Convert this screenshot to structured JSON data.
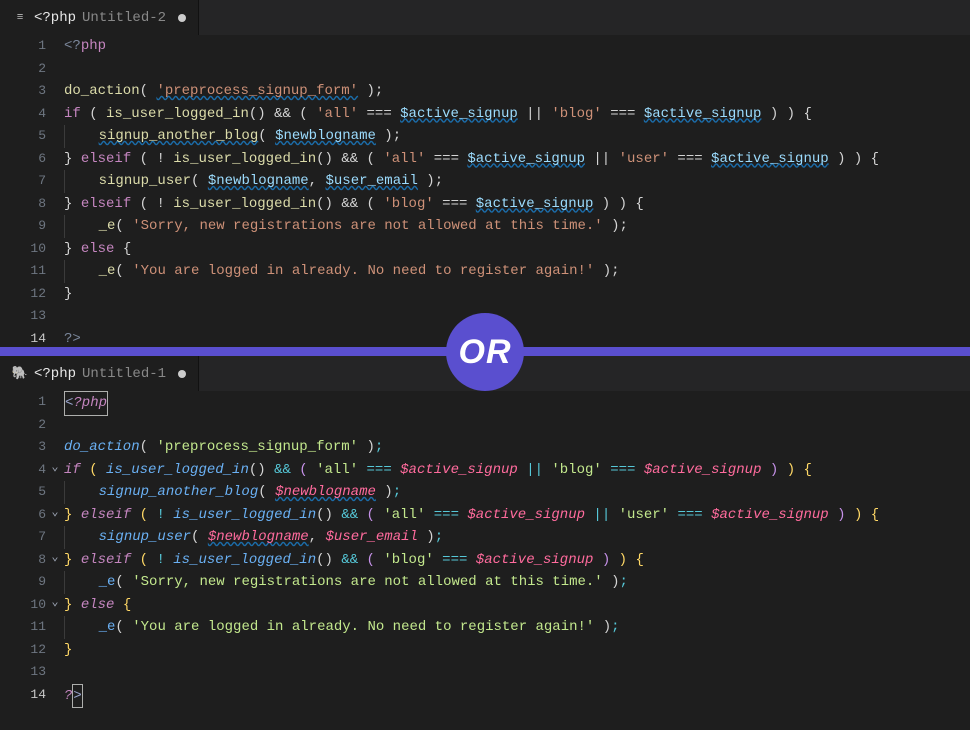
{
  "divider_label": "OR",
  "top": {
    "tab": {
      "lang": "<?php",
      "name": "Untitled-2"
    },
    "lines": [
      {
        "n": 1,
        "tokens": [
          [
            "<?",
            "t-tag"
          ],
          [
            "php",
            "t-kw"
          ]
        ]
      },
      {
        "n": 2,
        "tokens": []
      },
      {
        "n": 3,
        "tokens": [
          [
            "do_action",
            "t-fn"
          ],
          [
            "( ",
            "t-pun"
          ],
          [
            "'preprocess_signup_form'",
            "t-str wav"
          ],
          [
            " );",
            "t-pun"
          ]
        ]
      },
      {
        "n": 4,
        "tokens": [
          [
            "if",
            "t-kw"
          ],
          [
            " ( ",
            "t-pun"
          ],
          [
            "is_user_logged_in",
            "t-fn"
          ],
          [
            "() ",
            "t-pun"
          ],
          [
            "&& ",
            "t-op"
          ],
          [
            "( ",
            "t-pun"
          ],
          [
            "'all'",
            "t-str"
          ],
          [
            " === ",
            "t-op"
          ],
          [
            "$active_signup",
            "t-var wav"
          ],
          [
            " || ",
            "t-op"
          ],
          [
            "'blog'",
            "t-str"
          ],
          [
            " === ",
            "t-op"
          ],
          [
            "$active_signup",
            "t-var wav"
          ],
          [
            " ) ) {",
            "t-pun"
          ]
        ]
      },
      {
        "n": 5,
        "indent": 1,
        "tokens": [
          [
            "signup_another_blog",
            "t-fn wav"
          ],
          [
            "( ",
            "t-pun"
          ],
          [
            "$newblogname",
            "t-var wav"
          ],
          [
            " );",
            "t-pun"
          ]
        ]
      },
      {
        "n": 6,
        "tokens": [
          [
            "} ",
            "t-pun"
          ],
          [
            "elseif",
            "t-kw"
          ],
          [
            " ( ",
            "t-pun"
          ],
          [
            "! ",
            "t-op"
          ],
          [
            "is_user_logged_in",
            "t-fn"
          ],
          [
            "() ",
            "t-pun"
          ],
          [
            "&& ",
            "t-op"
          ],
          [
            "( ",
            "t-pun"
          ],
          [
            "'all'",
            "t-str"
          ],
          [
            " === ",
            "t-op"
          ],
          [
            "$active_signup",
            "t-var wav"
          ],
          [
            " || ",
            "t-op"
          ],
          [
            "'user'",
            "t-str"
          ],
          [
            " === ",
            "t-op"
          ],
          [
            "$active_signup",
            "t-var wav"
          ],
          [
            " ) ) {",
            "t-pun"
          ]
        ]
      },
      {
        "n": 7,
        "indent": 1,
        "tokens": [
          [
            "signup_user",
            "t-fn"
          ],
          [
            "( ",
            "t-pun"
          ],
          [
            "$newblogname",
            "t-var wav"
          ],
          [
            ", ",
            "t-pun"
          ],
          [
            "$user_email",
            "t-var wav"
          ],
          [
            " );",
            "t-pun"
          ]
        ]
      },
      {
        "n": 8,
        "tokens": [
          [
            "} ",
            "t-pun"
          ],
          [
            "elseif",
            "t-kw"
          ],
          [
            " ( ",
            "t-pun"
          ],
          [
            "! ",
            "t-op"
          ],
          [
            "is_user_logged_in",
            "t-fn"
          ],
          [
            "() ",
            "t-pun"
          ],
          [
            "&& ",
            "t-op"
          ],
          [
            "( ",
            "t-pun"
          ],
          [
            "'blog'",
            "t-str"
          ],
          [
            " === ",
            "t-op"
          ],
          [
            "$active_signup",
            "t-var wav"
          ],
          [
            " ) ) {",
            "t-pun"
          ]
        ]
      },
      {
        "n": 9,
        "indent": 1,
        "tokens": [
          [
            "_e",
            "t-fn"
          ],
          [
            "( ",
            "t-pun"
          ],
          [
            "'Sorry, new registrations are not allowed at this time.'",
            "t-str"
          ],
          [
            " );",
            "t-pun"
          ]
        ]
      },
      {
        "n": 10,
        "tokens": [
          [
            "} ",
            "t-pun"
          ],
          [
            "else",
            "t-kw"
          ],
          [
            " {",
            "t-pun"
          ]
        ]
      },
      {
        "n": 11,
        "indent": 1,
        "tokens": [
          [
            "_e",
            "t-fn"
          ],
          [
            "( ",
            "t-pun"
          ],
          [
            "'You are logged in already. No need to register again!'",
            "t-str"
          ],
          [
            " );",
            "t-pun"
          ]
        ]
      },
      {
        "n": 12,
        "tokens": [
          [
            "}",
            "t-pun"
          ]
        ]
      },
      {
        "n": 13,
        "tokens": []
      },
      {
        "n": 14,
        "cur": true,
        "tokens": [
          [
            "?>",
            "t-tag"
          ]
        ]
      }
    ]
  },
  "bottom": {
    "tab": {
      "lang": "<?php",
      "name": "Untitled-1"
    },
    "lines": [
      {
        "n": 1,
        "tokens": [
          [
            "<",
            "b-tag"
          ],
          [
            "?php",
            "b-kw"
          ]
        ],
        "boxstart": true
      },
      {
        "n": 2,
        "tokens": []
      },
      {
        "n": 3,
        "tokens": [
          [
            "do_action",
            "b-fn"
          ],
          [
            "( ",
            "t-pun"
          ],
          [
            "'preprocess_signup_form'",
            "b-str"
          ],
          [
            " )",
            "t-pun"
          ],
          [
            ";",
            "b-op"
          ]
        ]
      },
      {
        "n": 4,
        "fold": true,
        "tokens": [
          [
            "if",
            "b-kw"
          ],
          [
            " ",
            "t-pun"
          ],
          [
            "(",
            "b-brace"
          ],
          [
            " ",
            "t-pun"
          ],
          [
            "is_user_logged_in",
            "b-fn"
          ],
          [
            "()",
            " "
          ],
          [
            " ",
            "t-pun"
          ],
          [
            "&&",
            "b-op"
          ],
          [
            " ",
            "t-pun"
          ],
          [
            "(",
            "b-brace2"
          ],
          [
            " ",
            "t-pun"
          ],
          [
            "'all'",
            "b-str"
          ],
          [
            " ",
            "t-pun"
          ],
          [
            "===",
            "b-op"
          ],
          [
            " ",
            "t-pun"
          ],
          [
            "$active_signup",
            "b-var"
          ],
          [
            " ",
            "t-pun"
          ],
          [
            "||",
            "b-op"
          ],
          [
            " ",
            "t-pun"
          ],
          [
            "'blog'",
            "b-str"
          ],
          [
            " ",
            "t-pun"
          ],
          [
            "===",
            "b-op"
          ],
          [
            " ",
            "t-pun"
          ],
          [
            "$active_signup",
            "b-var"
          ],
          [
            " ",
            "t-pun"
          ],
          [
            ")",
            "b-brace2"
          ],
          [
            " ",
            "t-pun"
          ],
          [
            ")",
            "b-brace"
          ],
          [
            " ",
            "t-pun"
          ],
          [
            "{",
            "b-brace"
          ]
        ]
      },
      {
        "n": 5,
        "indent": 1,
        "tokens": [
          [
            "signup_another_blog",
            "b-fn"
          ],
          [
            "( ",
            "t-pun"
          ],
          [
            "$newblogname",
            "b-var wav"
          ],
          [
            " )",
            "t-pun"
          ],
          [
            ";",
            "b-op"
          ]
        ]
      },
      {
        "n": 6,
        "fold": true,
        "tokens": [
          [
            "}",
            "b-brace"
          ],
          [
            " ",
            "t-pun"
          ],
          [
            "elseif",
            "b-kw"
          ],
          [
            " ",
            "t-pun"
          ],
          [
            "(",
            "b-brace"
          ],
          [
            " ",
            "t-pun"
          ],
          [
            "!",
            "b-op"
          ],
          [
            " ",
            "t-pun"
          ],
          [
            "is_user_logged_in",
            "b-fn"
          ],
          [
            "()",
            " "
          ],
          [
            " ",
            "t-pun"
          ],
          [
            "&&",
            "b-op"
          ],
          [
            " ",
            "t-pun"
          ],
          [
            "(",
            "b-brace2"
          ],
          [
            " ",
            "t-pun"
          ],
          [
            "'all'",
            "b-str"
          ],
          [
            " ",
            "t-pun"
          ],
          [
            "===",
            "b-op"
          ],
          [
            " ",
            "t-pun"
          ],
          [
            "$active_signup",
            "b-var"
          ],
          [
            " ",
            "t-pun"
          ],
          [
            "||",
            "b-op"
          ],
          [
            " ",
            "t-pun"
          ],
          [
            "'user'",
            "b-str"
          ],
          [
            " ",
            "t-pun"
          ],
          [
            "===",
            "b-op"
          ],
          [
            " ",
            "t-pun"
          ],
          [
            "$active_signup",
            "b-var"
          ],
          [
            " ",
            "t-pun"
          ],
          [
            ")",
            "b-brace2"
          ],
          [
            " ",
            "t-pun"
          ],
          [
            ")",
            "b-brace"
          ],
          [
            " ",
            "t-pun"
          ],
          [
            "{",
            "b-brace"
          ]
        ]
      },
      {
        "n": 7,
        "indent": 1,
        "tokens": [
          [
            "signup_user",
            "b-fn"
          ],
          [
            "( ",
            "t-pun"
          ],
          [
            "$newblogname",
            "b-var wav"
          ],
          [
            ", ",
            "t-pun"
          ],
          [
            "$user_email",
            "b-var"
          ],
          [
            " )",
            "t-pun"
          ],
          [
            ";",
            "b-op"
          ]
        ]
      },
      {
        "n": 8,
        "fold": true,
        "tokens": [
          [
            "}",
            "b-brace"
          ],
          [
            " ",
            "t-pun"
          ],
          [
            "elseif",
            "b-kw"
          ],
          [
            " ",
            "t-pun"
          ],
          [
            "(",
            "b-brace"
          ],
          [
            " ",
            "t-pun"
          ],
          [
            "!",
            "b-op"
          ],
          [
            " ",
            "t-pun"
          ],
          [
            "is_user_logged_in",
            "b-fn"
          ],
          [
            "()",
            " "
          ],
          [
            " ",
            "t-pun"
          ],
          [
            "&&",
            "b-op"
          ],
          [
            " ",
            "t-pun"
          ],
          [
            "(",
            "b-brace2"
          ],
          [
            " ",
            "t-pun"
          ],
          [
            "'blog'",
            "b-str"
          ],
          [
            " ",
            "t-pun"
          ],
          [
            "===",
            "b-op"
          ],
          [
            " ",
            "t-pun"
          ],
          [
            "$active_signup",
            "b-var"
          ],
          [
            " ",
            "t-pun"
          ],
          [
            ")",
            "b-brace2"
          ],
          [
            " ",
            "t-pun"
          ],
          [
            ")",
            "b-brace"
          ],
          [
            " ",
            "t-pun"
          ],
          [
            "{",
            "b-brace"
          ]
        ]
      },
      {
        "n": 9,
        "indent": 1,
        "tokens": [
          [
            "_e",
            "b-e"
          ],
          [
            "( ",
            "t-pun"
          ],
          [
            "'Sorry, new registrations are not allowed at this time.'",
            "b-str"
          ],
          [
            " )",
            "t-pun"
          ],
          [
            ";",
            "b-op"
          ]
        ]
      },
      {
        "n": 10,
        "fold": true,
        "tokens": [
          [
            "}",
            "b-brace"
          ],
          [
            " ",
            "t-pun"
          ],
          [
            "else",
            "b-kw"
          ],
          [
            " ",
            "t-pun"
          ],
          [
            "{",
            "b-brace"
          ]
        ]
      },
      {
        "n": 11,
        "indent": 1,
        "tokens": [
          [
            "_e",
            "b-e"
          ],
          [
            "( ",
            "t-pun"
          ],
          [
            "'You are logged in already. No need to register again!'",
            "b-str"
          ],
          [
            " )",
            "t-pun"
          ],
          [
            ";",
            "b-op"
          ]
        ]
      },
      {
        "n": 12,
        "tokens": [
          [
            "}",
            "b-brace"
          ]
        ]
      },
      {
        "n": 13,
        "tokens": []
      },
      {
        "n": 14,
        "cur": true,
        "tokens": [
          [
            "?",
            "b-kw"
          ],
          [
            ">",
            "b-tag"
          ]
        ],
        "boxend": true
      }
    ]
  }
}
